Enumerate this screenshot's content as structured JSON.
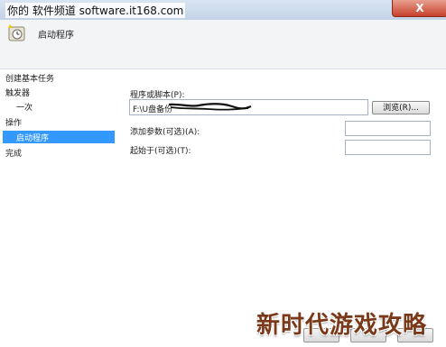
{
  "window": {
    "title": "你的 软件频道 software.it168.com",
    "close_label": "X"
  },
  "header": {
    "title": "启动程序",
    "icon": "clock-task-icon"
  },
  "nav": {
    "items": [
      {
        "label": "创建基本任务",
        "level": 0,
        "selected": false
      },
      {
        "label": "触发器",
        "level": 0,
        "selected": false
      },
      {
        "label": "一次",
        "level": 1,
        "selected": false
      },
      {
        "label": "操作",
        "level": 0,
        "selected": false
      },
      {
        "label": "启动程序",
        "level": 1,
        "selected": true
      },
      {
        "label": "完成",
        "level": 0,
        "selected": false
      }
    ],
    "selected_color": "#3399ff"
  },
  "form": {
    "program_label": "程序或脚本(P):",
    "program_value": "F:\\U盘备份",
    "browse_label": "浏览(R)...",
    "args_label": "添加参数(可选)(A):",
    "args_value": "",
    "startin_label": "起始于(可选)(T):",
    "startin_value": ""
  },
  "watermark": {
    "text": "新时代游戏攻略"
  }
}
